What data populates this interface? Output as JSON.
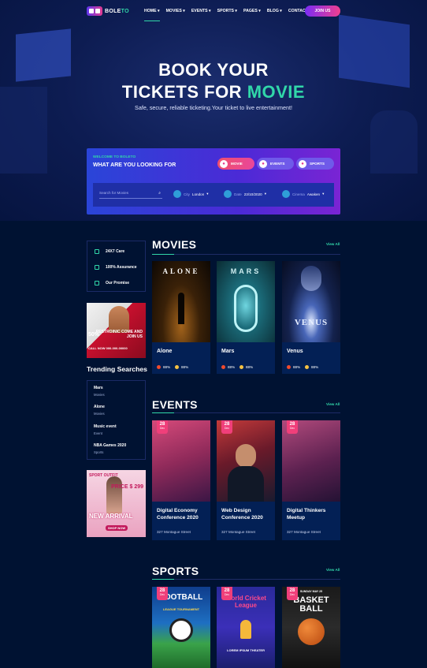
{
  "brand": {
    "name_a": "BOLE",
    "name_b": "TO"
  },
  "nav": [
    {
      "label": "HOME ▾"
    },
    {
      "label": "MOVIES ▾"
    },
    {
      "label": "EVENTS ▾"
    },
    {
      "label": "SPORTS ▾"
    },
    {
      "label": "PAGES ▾"
    },
    {
      "label": "BLOG ▾"
    },
    {
      "label": "CONTACT"
    }
  ],
  "join_label": "JOIN US",
  "hero": {
    "line1": "BOOK YOUR",
    "line2_a": "TICKETS FOR ",
    "line2_b": "MOVIE",
    "subtitle": "Safe, secure, reliable ticketing.Your ticket to live entertainment!"
  },
  "booking": {
    "welcome": "WELCOME TO BOLETO",
    "heading": "WHAT ARE YOU LOOKING FOR",
    "types": [
      "MOVIE",
      "EVENTS",
      "SPORTS"
    ],
    "search_placeholder": "Search for Movies",
    "filters": [
      {
        "label": "City",
        "value": "London"
      },
      {
        "label": "Date",
        "value": "23/10/2020"
      },
      {
        "label": "Cinema",
        "value": "Awaken"
      }
    ]
  },
  "features": [
    "24X7 Care",
    "100% Assurance",
    "Our Promise"
  ],
  "ad1": {
    "pct": "50%",
    "headline": "RESTROINIC COME AND JOIN US",
    "call": "CALL NOW 000-000-00000"
  },
  "trending": {
    "title": "Trending Searches",
    "items": [
      {
        "name": "Mars",
        "cat": "Movies"
      },
      {
        "name": "Alone",
        "cat": "Movies"
      },
      {
        "name": "Music event",
        "cat": "Event"
      },
      {
        "name": "NBA Games 2020",
        "cat": "Sports"
      }
    ]
  },
  "ad2": {
    "top": "SPORT OUTFIT",
    "price": "PRICE $ 299",
    "headline": "NEW ARRIVAL",
    "cta": "SHOP NOW"
  },
  "movies": {
    "title": "MOVIES",
    "view_all": "View All",
    "items": [
      {
        "name": "Alone",
        "poster": "ALONE",
        "tomato": "88%",
        "audience": "88%"
      },
      {
        "name": "Mars",
        "poster": "MARS",
        "tomato": "88%",
        "audience": "88%"
      },
      {
        "name": "Venus",
        "poster": "VENUS",
        "tomato": "88%",
        "audience": "88%"
      }
    ]
  },
  "events": {
    "title": "EVENTS",
    "view_all": "View All",
    "items": [
      {
        "day": "28",
        "month": "Dec",
        "name": "Digital Economy Conference 2020",
        "addr": "327 Montague Street"
      },
      {
        "day": "28",
        "month": "Dec",
        "name": "Web Design Conference 2020",
        "addr": "327 Montague Street"
      },
      {
        "day": "28",
        "month": "Dec",
        "name": "Digital Thinkers Meetup",
        "addr": "327 Montague Street"
      }
    ]
  },
  "sports": {
    "title": "SPORTS",
    "view_all": "View All",
    "items": [
      {
        "day": "28",
        "month": "Dec",
        "poster": "FOOTBALL",
        "sub": "LEAGUE TOURNAMENT"
      },
      {
        "day": "28",
        "month": "Dec",
        "poster": "World Cricket League",
        "sub": "LOREM IPSUM THEATER"
      },
      {
        "day": "28",
        "month": "Dec",
        "poster": "BASKET BALL",
        "sub": "SUNDAY MAY 25"
      }
    ]
  }
}
